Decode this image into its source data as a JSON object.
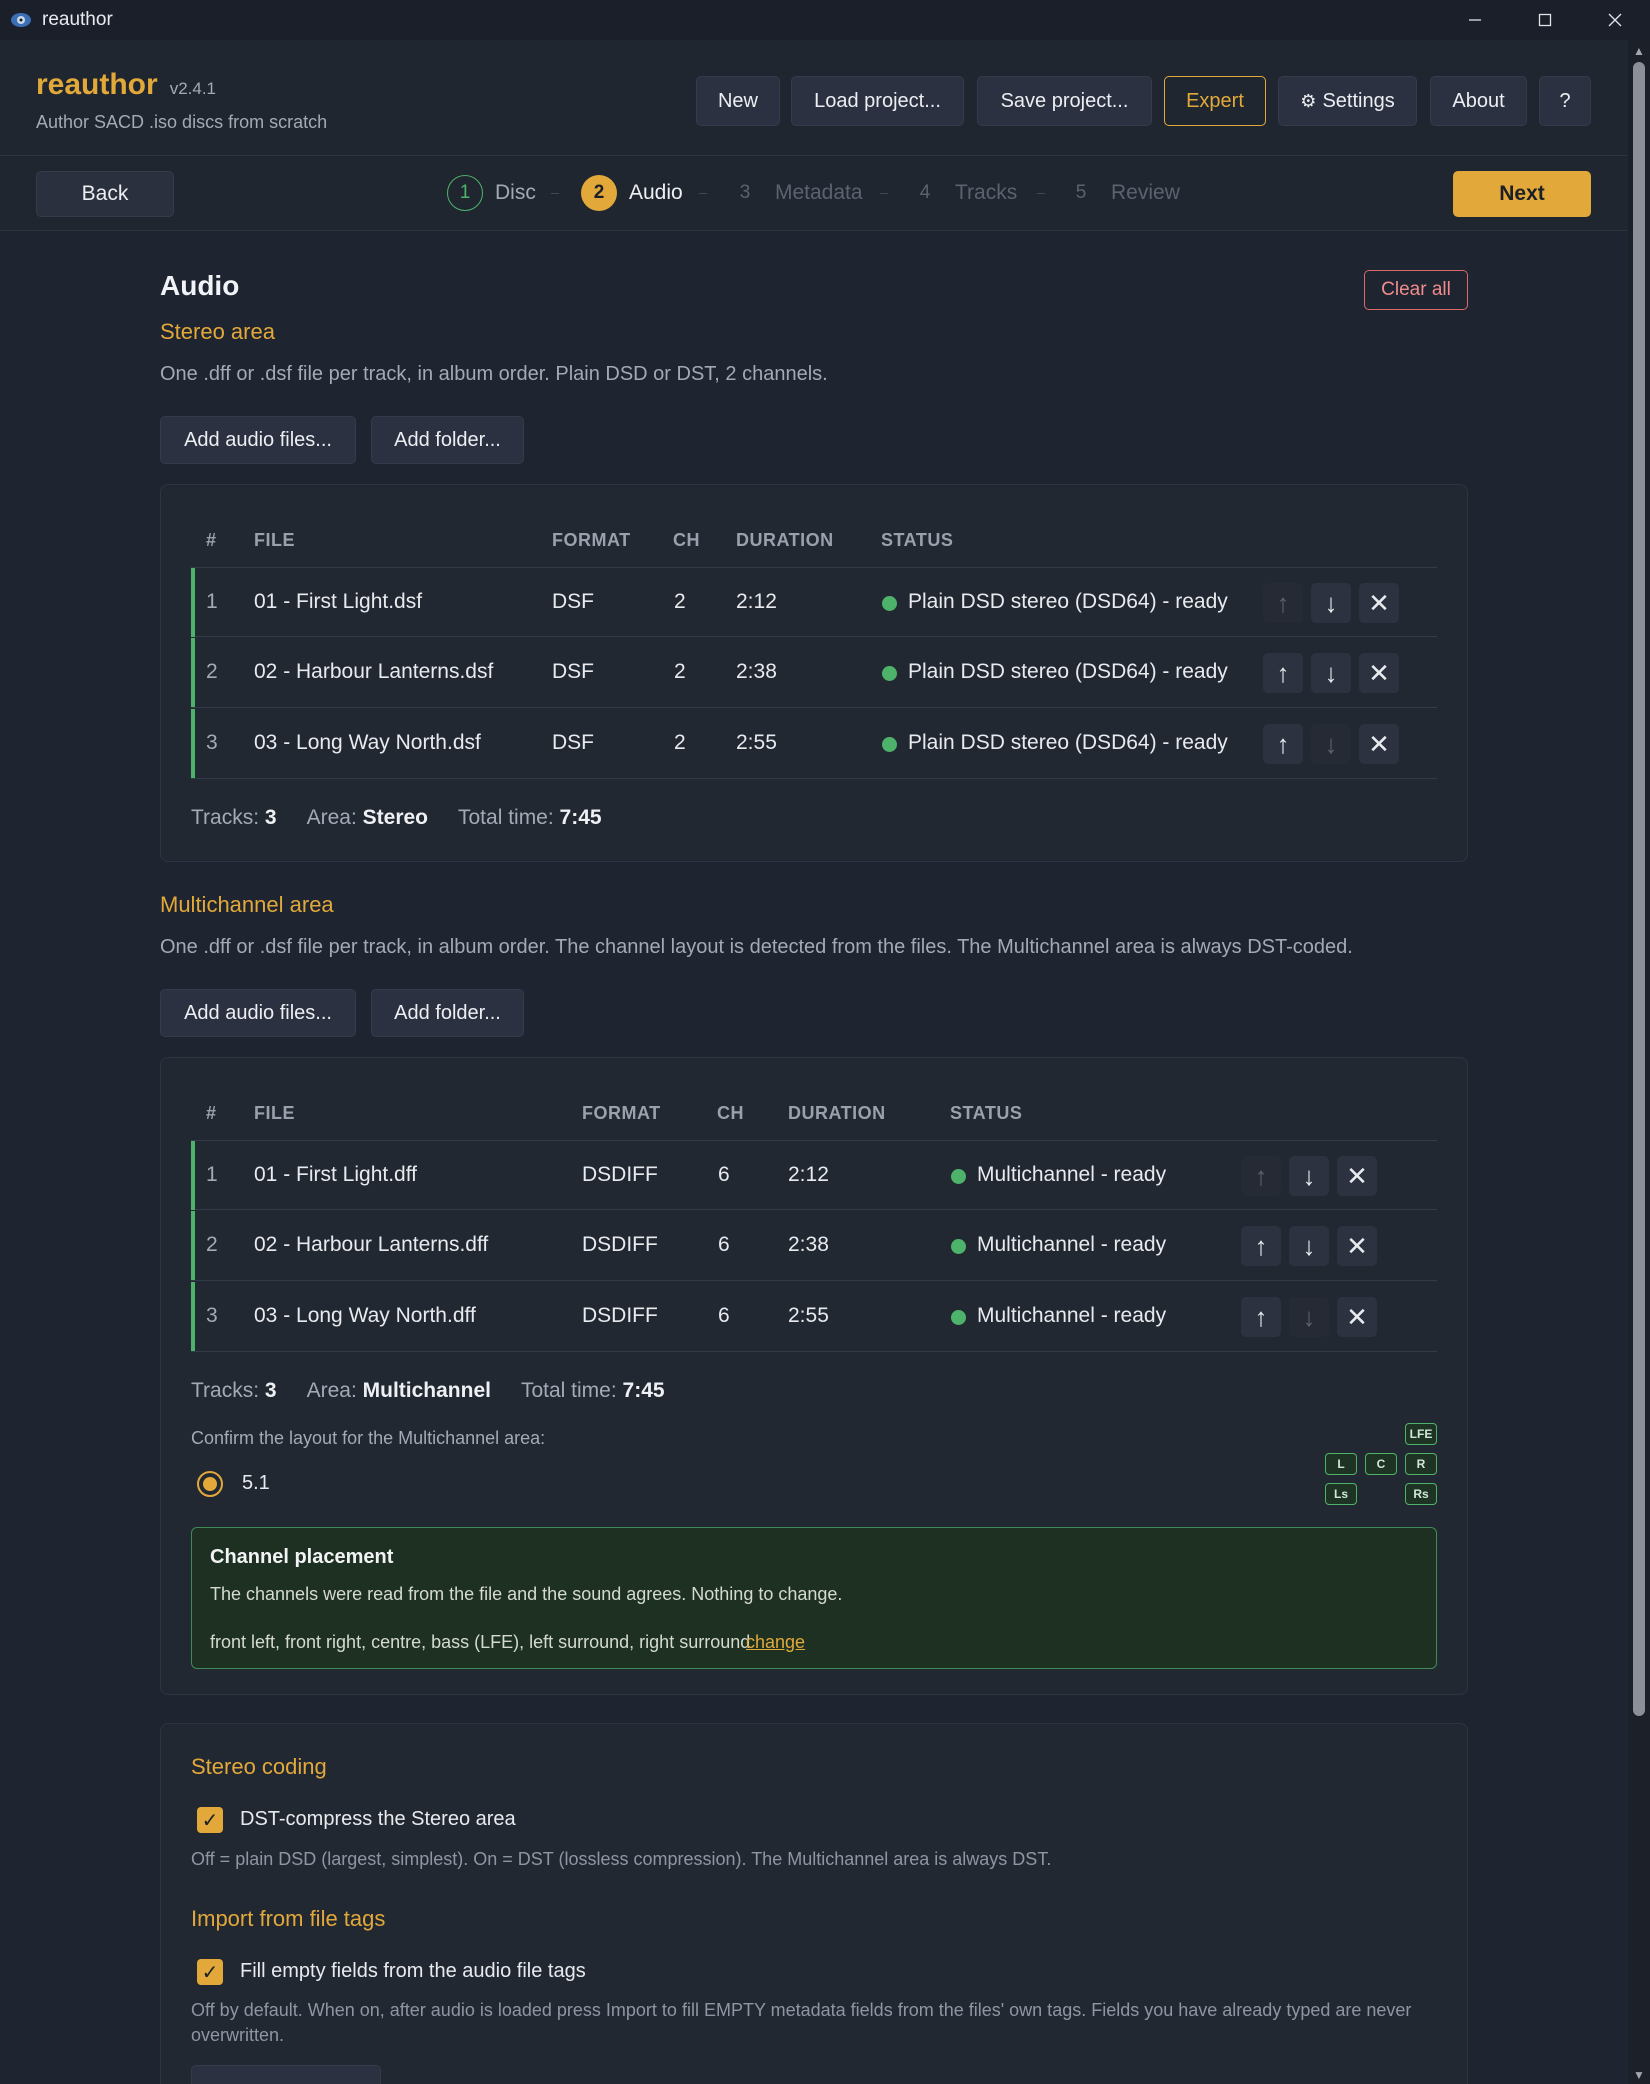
{
  "window": {
    "title": "reauthor"
  },
  "header": {
    "app_name": "reauthor",
    "version": "v2.4.1",
    "subtitle": "Author SACD .iso discs from scratch",
    "buttons": {
      "new": "New",
      "load": "Load project...",
      "save": "Save project...",
      "expert": "Expert",
      "settings": "Settings",
      "about": "About",
      "help": "?"
    }
  },
  "nav": {
    "back": "Back",
    "next": "Next",
    "steps": [
      {
        "num": "1",
        "label": "Disc",
        "state": "done"
      },
      {
        "num": "2",
        "label": "Audio",
        "state": "active"
      },
      {
        "num": "3",
        "label": "Metadata",
        "state": "todo"
      },
      {
        "num": "4",
        "label": "Tracks",
        "state": "todo"
      },
      {
        "num": "5",
        "label": "Review",
        "state": "todo"
      }
    ]
  },
  "page": {
    "title": "Audio",
    "clear_all": "Clear all"
  },
  "stereo": {
    "title": "Stereo area",
    "description": "One .dff or .dsf file per track, in album order. Plain DSD or DST, 2 channels.",
    "add_files": "Add audio files...",
    "add_folder": "Add folder...",
    "columns": [
      "#",
      "FILE",
      "FORMAT",
      "CH",
      "DURATION",
      "STATUS"
    ],
    "rows": [
      {
        "idx": "1",
        "file": "01 - First Light.dsf",
        "format": "DSF",
        "ch": "2",
        "duration": "2:12",
        "status": "Plain DSD stereo (DSD64) - ready"
      },
      {
        "idx": "2",
        "file": "02 - Harbour Lanterns.dsf",
        "format": "DSF",
        "ch": "2",
        "duration": "2:38",
        "status": "Plain DSD stereo (DSD64) - ready"
      },
      {
        "idx": "3",
        "file": "03 - Long Way North.dsf",
        "format": "DSF",
        "ch": "2",
        "duration": "2:55",
        "status": "Plain DSD stereo (DSD64) - ready"
      }
    ],
    "summary": {
      "tracks_label": "Tracks:",
      "tracks": "3",
      "area_label": "Area:",
      "area": "Stereo",
      "time_label": "Total time:",
      "time": "7:45"
    }
  },
  "multichannel": {
    "title": "Multichannel area",
    "description": "One .dff or .dsf file per track, in album order. The channel layout is detected from the files. The Multichannel area is always DST-coded.",
    "add_files": "Add audio files...",
    "add_folder": "Add folder...",
    "columns": [
      "#",
      "FILE",
      "FORMAT",
      "CH",
      "DURATION",
      "STATUS"
    ],
    "rows": [
      {
        "idx": "1",
        "file": "01 - First Light.dff",
        "format": "DSDIFF",
        "ch": "6",
        "duration": "2:12",
        "status": "Multichannel - ready"
      },
      {
        "idx": "2",
        "file": "02 - Harbour Lanterns.dff",
        "format": "DSDIFF",
        "ch": "6",
        "duration": "2:38",
        "status": "Multichannel - ready"
      },
      {
        "idx": "3",
        "file": "03 - Long Way North.dff",
        "format": "DSDIFF",
        "ch": "6",
        "duration": "2:55",
        "status": "Multichannel - ready"
      }
    ],
    "summary": {
      "tracks_label": "Tracks:",
      "tracks": "3",
      "area_label": "Area:",
      "area": "Multichannel",
      "time_label": "Total time:",
      "time": "7:45"
    },
    "layout_prompt": "Confirm the layout for the Multichannel area:",
    "layout_option": "5.1",
    "speakers": {
      "lfe": "LFE",
      "l": "L",
      "c": "C",
      "r": "R",
      "ls": "Ls",
      "rs": "Rs"
    },
    "placement": {
      "title": "Channel placement",
      "text": "The channels were read from the file and the sound agrees. Nothing to change.",
      "channels": "front left, front right, centre, bass (LFE), left surround, right surround",
      "change": "change"
    }
  },
  "options": {
    "stereo_coding_title": "Stereo coding",
    "dst_label": "DST-compress the Stereo area",
    "dst_checked": true,
    "dst_hint": "Off = plain DSD (largest, simplest). On = DST (lossless compression). The Multichannel area is always DST.",
    "import_title": "Import from file tags",
    "import_label": "Fill empty fields from the audio file tags",
    "import_checked": true,
    "import_hint": "Off by default. When on, after audio is loaded press Import to fill EMPTY metadata fields from the files' own tags. Fields you have already typed are never overwritten."
  },
  "colors": {
    "accent": "#e2a93a",
    "ok": "#4db36b",
    "danger": "#d86a6a",
    "background": "#1e2430"
  },
  "icons": {
    "app": "app-logo-icon",
    "minimize": "minimize-icon",
    "maximize": "maximize-icon",
    "close": "close-icon",
    "settings": "gear-icon",
    "up": "arrow-up-icon",
    "down": "arrow-down-icon",
    "remove": "x-icon"
  }
}
